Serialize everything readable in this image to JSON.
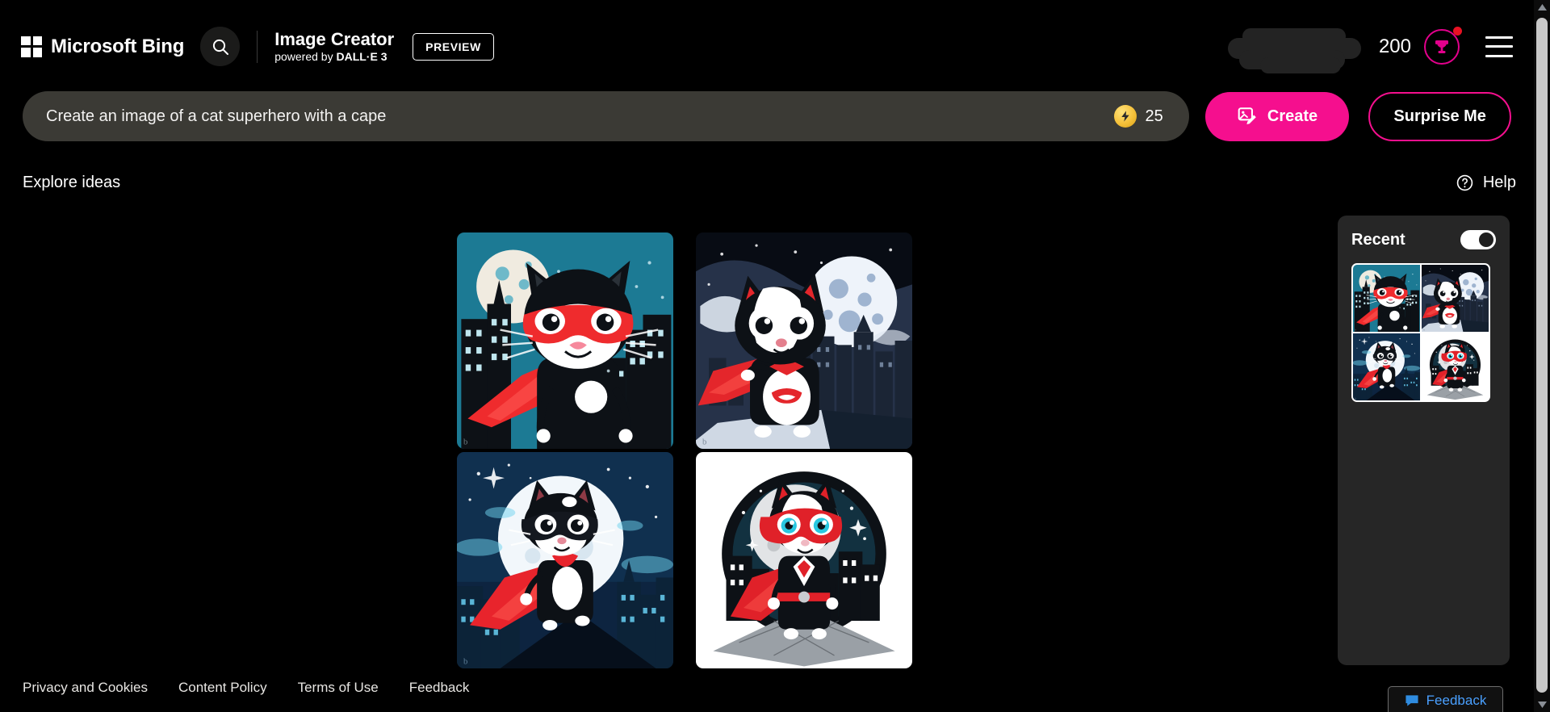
{
  "header": {
    "brand": "Microsoft Bing",
    "search_icon": "search-icon",
    "app_title": "Image Creator",
    "app_subtitle_prefix": "powered by ",
    "app_subtitle_brand": "DALL·E 3",
    "preview_label": "PREVIEW",
    "rewards_points": "200",
    "rewards_icon": "rewards-trophy-icon",
    "notification_dot": true,
    "menu_icon": "hamburger-menu-icon",
    "account_redacted": true,
    "accent_color": "#e3008c",
    "notification_color": "#e81123"
  },
  "prompt": {
    "value": "Create an image of a cat superhero with a cape",
    "placeholder": "Create an image of a cat superhero with a cape",
    "boost_icon": "boost-coin-icon",
    "boost_count": "25",
    "create_label": "Create",
    "create_icon": "image-edit-icon",
    "create_color": "#f50f8e",
    "surprise_label": "Surprise Me"
  },
  "explore": {
    "title": "Explore ideas",
    "help_label": "Help",
    "help_icon": "question-circle-icon"
  },
  "gallery": {
    "images": [
      {
        "name": "cat-superhero-teal-city",
        "alt": "Black and white cat superhero with red mask and red cape in front of a teal night sky with a full moon and city skyline",
        "bg": "#1c7a94",
        "moon": "#f0ebe0",
        "cape": "#ef2b2d",
        "mask": "#ef2b2d"
      },
      {
        "name": "cat-superhero-dark-moon-rooftop",
        "alt": "Tuxedo cat superhero with red cape standing on a rooftop under a large pale moon, dark blue monochrome city",
        "bg": "#0b0f18",
        "moon": "#e9eef6",
        "cape": "#e4262b",
        "mask": "#e4262b"
      },
      {
        "name": "cat-superhero-blue-night-moon",
        "alt": "Black cat superhero with dark mask and red cape standing on a rooftop in front of a huge white moon in a starry blue sky",
        "bg": "#0e2a44",
        "moon": "#f2f7fb",
        "cape": "#e8242c",
        "mask": "#111318"
      },
      {
        "name": "cat-superhero-white-circle-vignette",
        "alt": "Cat superhero with red mask and red cape standing on a plaza inside a dark circular vignette on a white background",
        "bg": "#ffffff",
        "moon": "#dcdcdc",
        "cape": "#e02129",
        "mask": "#e02129"
      }
    ]
  },
  "recent": {
    "title": "Recent",
    "toggle_on": true,
    "thumbnail_set_name": "recent-cat-superhero-set"
  },
  "footer": {
    "links": [
      {
        "label": "Privacy and Cookies",
        "name": "privacy-and-cookies-link"
      },
      {
        "label": "Content Policy",
        "name": "content-policy-link"
      },
      {
        "label": "Terms of Use",
        "name": "terms-of-use-link"
      },
      {
        "label": "Feedback",
        "name": "feedback-link"
      }
    ],
    "feedback_button": "Feedback",
    "feedback_icon": "speech-bubble-icon"
  },
  "scrollbar": {
    "position": "top",
    "up_arrow_icon": "scroll-up-arrow-icon",
    "down_arrow_icon": "scroll-down-arrow-icon"
  }
}
